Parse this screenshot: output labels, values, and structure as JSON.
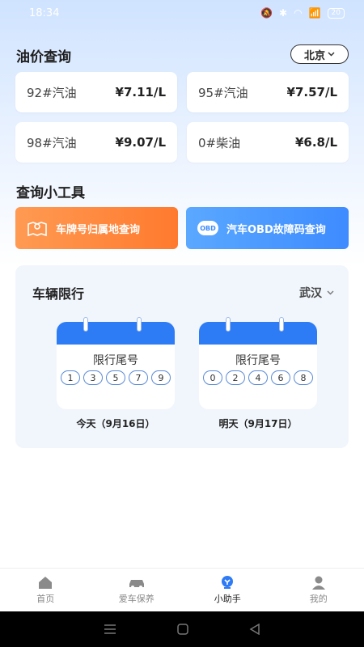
{
  "status_bar": {
    "time": "18:34",
    "signal": "📶",
    "battery": "20"
  },
  "oil_price": {
    "title": "油价查询",
    "city": "北京",
    "items": [
      {
        "name": "92#汽油",
        "price": "¥7.11/L"
      },
      {
        "name": "95#汽油",
        "price": "¥7.57/L"
      },
      {
        "name": "98#汽油",
        "price": "¥9.07/L"
      },
      {
        "name": "0#柴油",
        "price": "¥6.8/L"
      }
    ]
  },
  "tools": {
    "title": "查询小工具",
    "plate_lookup": "车牌号归属地查询",
    "obd_badge": "OBD",
    "obd_lookup": "汽车OBD故障码查询"
  },
  "restriction": {
    "title": "车辆限行",
    "city": "武汉",
    "today": {
      "label": "限行尾号",
      "numbers": [
        "1",
        "3",
        "5",
        "7",
        "9"
      ],
      "date": "今天（9月16日）"
    },
    "tomorrow": {
      "label": "限行尾号",
      "numbers": [
        "0",
        "2",
        "4",
        "6",
        "8"
      ],
      "date": "明天（9月17日）"
    }
  },
  "tabs": [
    {
      "label": "首页",
      "icon": "home-icon"
    },
    {
      "label": "爱车保养",
      "icon": "car-icon"
    },
    {
      "label": "小助手",
      "icon": "assistant-icon"
    },
    {
      "label": "我的",
      "icon": "user-icon"
    }
  ],
  "colors": {
    "accent_blue": "#2e7bf6",
    "accent_orange": "#ff7a2e"
  }
}
